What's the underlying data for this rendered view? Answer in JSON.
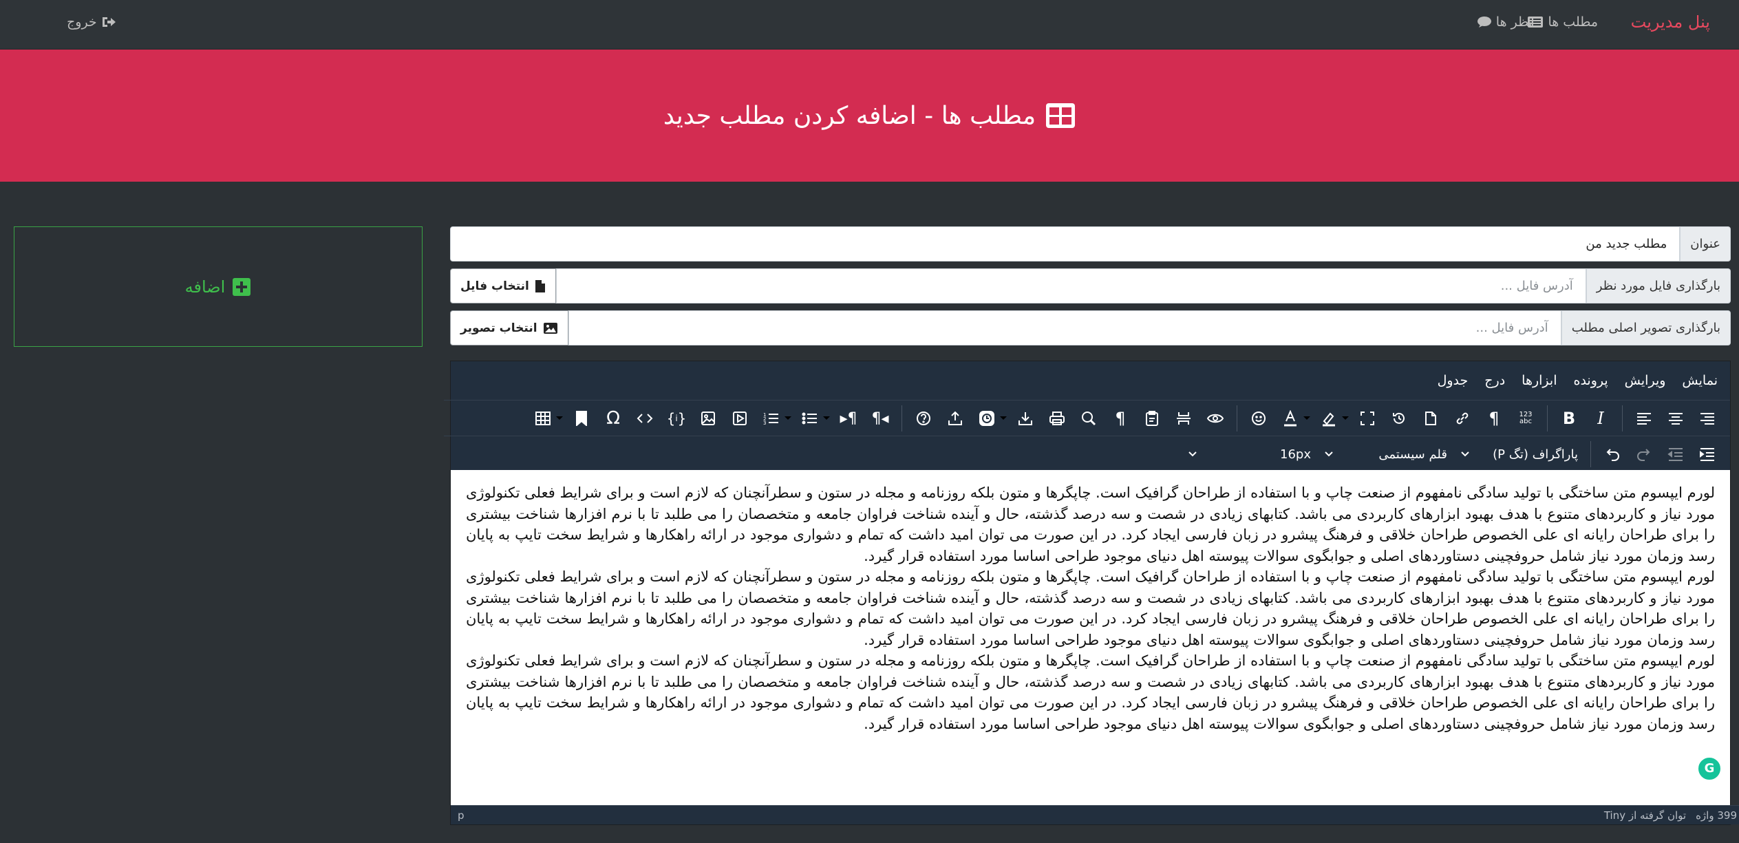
{
  "navbar": {
    "brand": "پنل مدیریت",
    "links": [
      {
        "label": "مطلب ها",
        "icon": "list-icon"
      },
      {
        "label": "نظر ها",
        "icon": "comment-icon"
      }
    ],
    "logout": {
      "label": "خروج",
      "icon": "sign-out-icon"
    }
  },
  "header": {
    "title": "مطلب ها - اضافه کردن مطلب جدید",
    "icon": "table-icon"
  },
  "add_button": {
    "label": "اضافه",
    "icon": "plus-square-icon"
  },
  "form": {
    "title": {
      "label": "عنوان",
      "value": "مطلب جدید من"
    },
    "file": {
      "label": "بارگذاری فایل مورد نظر",
      "placeholder": "آدرس فایل ...",
      "button": "انتخاب فایل",
      "button_icon": "file-icon"
    },
    "image": {
      "label": "بارگذاری تصویر اصلی مطلب",
      "placeholder": "آدرس فایل ...",
      "button": "انتخاب تصویر",
      "button_icon": "image-icon"
    }
  },
  "editor": {
    "menu": [
      "نمایش",
      "ویرایش",
      "پرونده",
      "ابزارها",
      "درج",
      "جدول"
    ],
    "toolbar_row1": [
      "align-right-icon",
      "align-center-icon",
      "align-left-icon",
      "italic-icon",
      "bold-icon",
      "spellcheck-icon",
      "paragraph-mark-icon",
      "link-icon",
      "new-document-icon",
      "restore-draft-icon",
      "fullscreen-icon",
      "highlight-color-icon",
      "text-color-icon",
      "emoticons-icon",
      "preview-icon",
      "page-break-icon",
      "paste-text-icon",
      "show-blocks-icon",
      "search-replace-icon",
      "print-icon",
      "save-icon",
      "date-time-icon",
      "upload-icon",
      "help-icon",
      "rtl-icon",
      "ltr-icon",
      "bullet-list-icon",
      "numbered-list-icon",
      "media-icon",
      "image-insert-icon",
      "template-icon",
      "code-icon",
      "special-char-icon",
      "anchor-icon",
      "table-icon"
    ],
    "toolbar_row2": [
      "indent-icon",
      "outdent-icon",
      "redo-icon",
      "undo-icon"
    ],
    "block_format": "(P تگ) پاراگراف",
    "font_family": "قلم سیستمی",
    "font_size": "16px",
    "paragraphs": [
      "لورم ایپسوم متن ساختگی با تولید سادگی نامفهوم از صنعت چاپ و با استفاده از طراحان گرافیک است. چاپگرها و متون بلکه روزنامه و مجله در ستون و سطرآنچنان که لازم است و برای شرایط فعلی تکنولوژی مورد نیاز و کاربردهای متنوع با هدف بهبود ابزارهای کاربردی می باشد. کتابهای زیادی در شصت و سه درصد گذشته، حال و آینده شناخت فراوان جامعه و متخصصان را می طلبد تا با نرم افزارها شناخت بیشتری را برای طراحان رایانه ای علی الخصوص طراحان خلاقی و فرهنگ پیشرو در زبان فارسی ایجاد کرد. در این صورت می توان امید داشت که تمام و دشواری موجود در ارائه راهکارها و شرایط سخت تایپ به پایان رسد وزمان مورد نیاز شامل حروفچینی دستاوردهای اصلی و جوابگوی سوالات پیوسته اهل دنیای موجود طراحی اساسا مورد استفاده قرار گیرد.",
      "لورم ایپسوم متن ساختگی با تولید سادگی نامفهوم از صنعت چاپ و با استفاده از طراحان گرافیک است. چاپگرها و متون بلکه روزنامه و مجله در ستون و سطرآنچنان که لازم است و برای شرایط فعلی تکنولوژی مورد نیاز و کاربردهای متنوع با هدف بهبود ابزارهای کاربردی می باشد. کتابهای زیادی در شصت و سه درصد گذشته، حال و آینده شناخت فراوان جامعه و متخصصان را می طلبد تا با نرم افزارها شناخت بیشتری را برای طراحان رایانه ای علی الخصوص طراحان خلاقی و فرهنگ پیشرو در زبان فارسی ایجاد کرد. در این صورت می توان امید داشت که تمام و دشواری موجود در ارائه راهکارها و شرایط سخت تایپ به پایان رسد وزمان مورد نیاز شامل حروفچینی دستاوردهای اصلی و جوابگوی سوالات پیوسته اهل دنیای موجود طراحی اساسا مورد استفاده قرار گیرد.",
      "لورم ایپسوم متن ساختگی با تولید سادگی نامفهوم از صنعت چاپ و با استفاده از طراحان گرافیک است. چاپگرها و متون بلکه روزنامه و مجله در ستون و سطرآنچنان که لازم است و برای شرایط فعلی تکنولوژی مورد نیاز و کاربردهای متنوع با هدف بهبود ابزارهای کاربردی می باشد. کتابهای زیادی در شصت و سه درصد گذشته، حال و آینده شناخت فراوان جامعه و متخصصان را می طلبد تا با نرم افزارها شناخت بیشتری را برای طراحان رایانه ای علی الخصوص طراحان خلاقی و فرهنگ پیشرو در زبان فارسی ایجاد کرد. در این صورت می توان امید داشت که تمام و دشواری موجود در ارائه راهکارها و شرایط سخت تایپ به پایان رسد وزمان مورد نیاز شامل حروفچینی دستاوردهای اصلی و جوابگوی سوالات پیوسته اهل دنیای موجود طراحی اساسا مورد استفاده قرار گیرد."
    ],
    "status_path": "p",
    "word_count": "399 واژه",
    "branding": "توان گرفته از Tiny"
  },
  "colors": {
    "brand_red": "#e8495f",
    "header_bg": "#d32c51",
    "success": "#3fbf4c",
    "editor_bg": "#222f3e"
  }
}
